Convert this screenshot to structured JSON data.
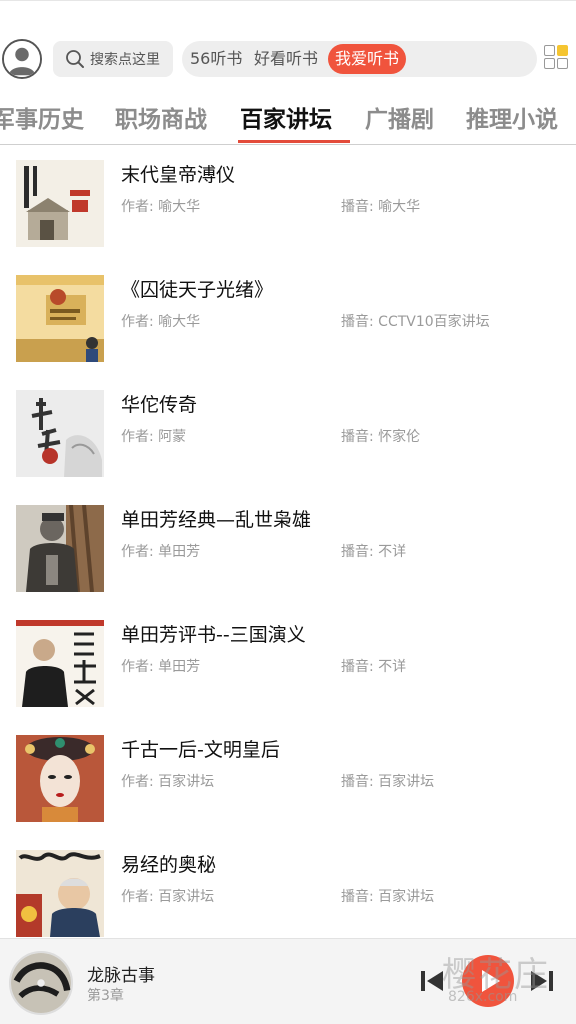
{
  "header": {
    "search_placeholder": "搜索点这里",
    "quick_links": [
      "56听书",
      "好看听书",
      "我爱听书"
    ],
    "active_link": "我爱听书"
  },
  "tabs": [
    "军事历史",
    "职场商战",
    "百家讲坛",
    "广播剧",
    "推理小说"
  ],
  "active_tab": "百家讲坛",
  "books": [
    {
      "title": "末代皇帝溥仪",
      "author": "作者: 喻大华",
      "narrator": "播音: 喻大华"
    },
    {
      "title": "《囚徒天子光绪》",
      "author": "作者: 喻大华",
      "narrator": "播音: CCTV10百家讲坛"
    },
    {
      "title": "华佗传奇",
      "author": "作者: 阿蒙",
      "narrator": "播音: 怀家伦"
    },
    {
      "title": "单田芳经典—乱世枭雄",
      "author": "作者: 单田芳",
      "narrator": "播音: 不详"
    },
    {
      "title": "单田芳评书--三国演义",
      "author": "作者: 单田芳",
      "narrator": "播音: 不详"
    },
    {
      "title": "千古一后-文明皇后",
      "author": "作者: 百家讲坛",
      "narrator": "播音: 百家讲坛"
    },
    {
      "title": "易经的奥秘",
      "author": "作者: 百家讲坛",
      "narrator": "播音: 百家讲坛"
    }
  ],
  "player": {
    "title": "龙脉古事",
    "chapter": "第3章"
  },
  "watermark": {
    "main": "樱花庄",
    "sub": "826x.com"
  },
  "colors": {
    "accent": "#f0543d",
    "tab_underline": "#e34b3a"
  },
  "icons": [
    "avatar-icon",
    "search-icon",
    "grid-menu-icon",
    "previous-icon",
    "play-icon",
    "next-icon"
  ]
}
